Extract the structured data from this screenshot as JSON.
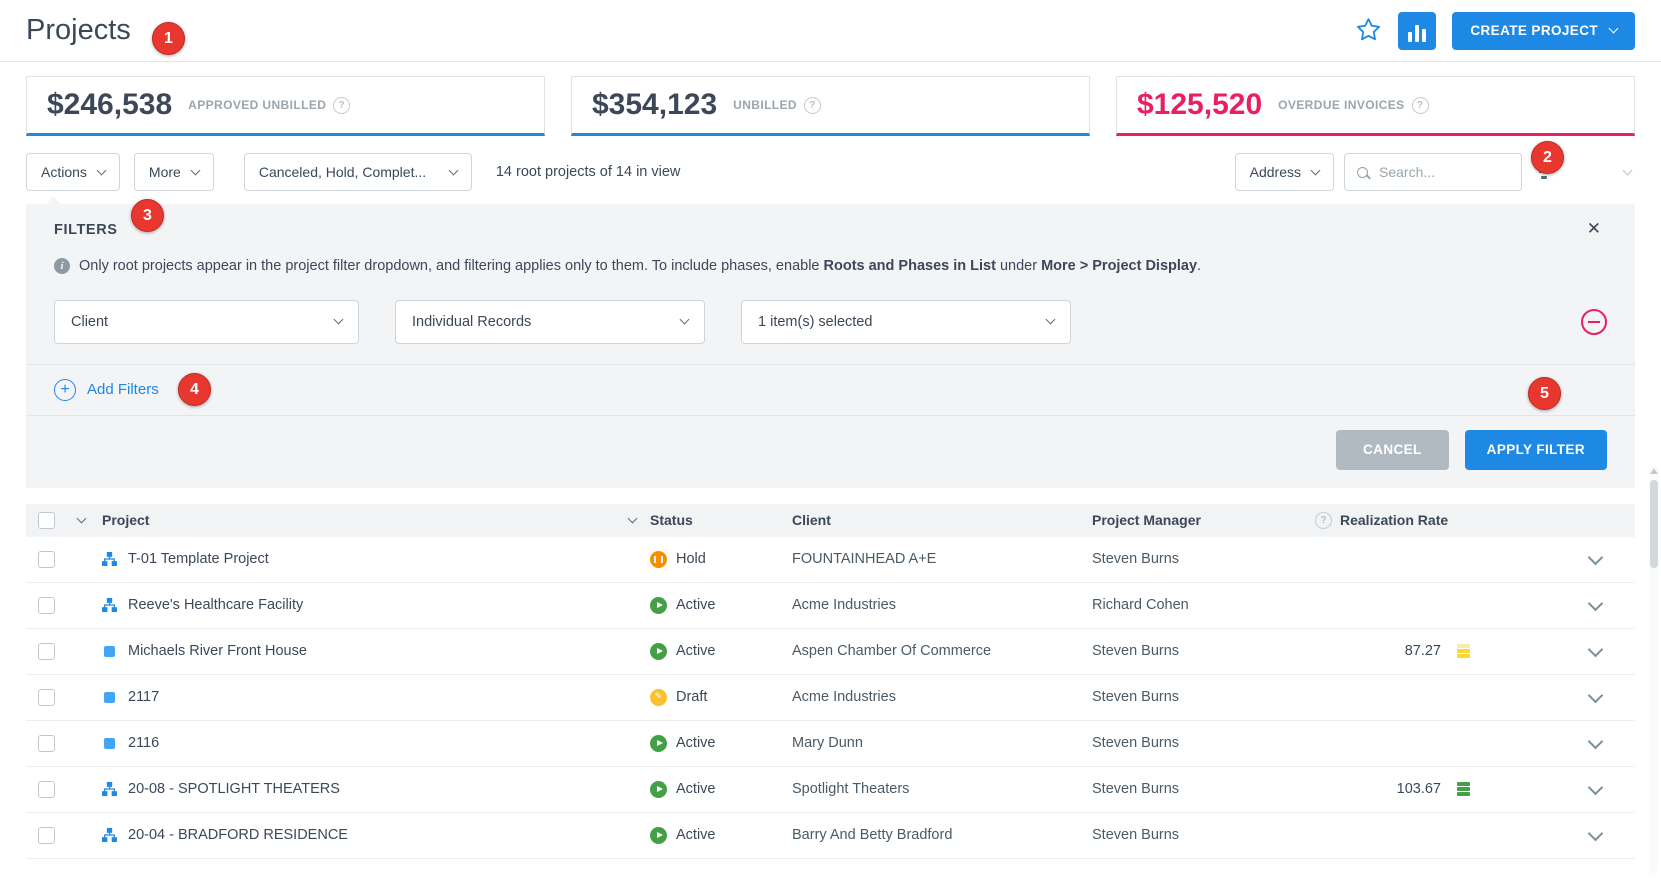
{
  "page": {
    "title": "Projects"
  },
  "header": {
    "create_button_label": "CREATE PROJECT"
  },
  "icons": {
    "info": "i",
    "help": "?",
    "close": "✕",
    "plus": "+"
  },
  "colors": {
    "accent_blue": "#1e88e5",
    "overdue_pink": "#e91e63",
    "badge_red": "#e8372f",
    "status_active": "#43a047",
    "status_hold": "#fb8c00",
    "status_draft": "#fbc02d"
  },
  "stats": {
    "cards": [
      {
        "value": "$246,538",
        "label": "APPROVED UNBILLED",
        "accent": "#1e88e5"
      },
      {
        "value": "$354,123",
        "label": "UNBILLED",
        "accent": "#1e88e5"
      },
      {
        "value": "$125,520",
        "label": "OVERDUE INVOICES",
        "accent": "#e91e63",
        "value_color": "#e91e63"
      }
    ]
  },
  "toolbar": {
    "actions_label": "Actions",
    "more_label": "More",
    "status_dropdown_value": "Canceled, Hold, Complet...",
    "count_text": "14 root projects of 14 in view",
    "address_label": "Address",
    "search_placeholder": "Search..."
  },
  "filters": {
    "title": "FILTERS",
    "info": {
      "text_1": "Only root projects appear in the project filter dropdown, and filtering applies only to them. To include phases, enable ",
      "bold_1": "Roots and Phases in List",
      "text_2": " under ",
      "bold_2": "More > Project Display",
      "text_3": "."
    },
    "row": {
      "field": "Client",
      "record_type": "Individual Records",
      "selection": "1 item(s) selected"
    },
    "add_filters_label": "Add Filters",
    "cancel_label": "CANCEL",
    "apply_label": "APPLY FILTER"
  },
  "table": {
    "headers": {
      "project": "Project",
      "status": "Status",
      "client": "Client",
      "manager": "Project Manager",
      "realization": "Realization Rate"
    },
    "rows": [
      {
        "name": "T-01 Template Project",
        "icon": "hierarchy",
        "status": "Hold",
        "status_type": "hold",
        "client": "FOUNTAINHEAD A+E",
        "manager": "Steven Burns",
        "rate": "",
        "rate_level": ""
      },
      {
        "name": "Reeve's Healthcare Facility",
        "icon": "hierarchy",
        "status": "Active",
        "status_type": "active",
        "client": "Acme Industries",
        "manager": "Richard Cohen",
        "rate": "",
        "rate_level": ""
      },
      {
        "name": "Michaels River Front House",
        "icon": "square",
        "status": "Active",
        "status_type": "active",
        "client": "Aspen Chamber Of Commerce",
        "manager": "Steven Burns",
        "rate": "87.27",
        "rate_level": "medium"
      },
      {
        "name": "2117",
        "icon": "square",
        "status": "Draft",
        "status_type": "draft",
        "client": "Acme Industries",
        "manager": "Steven Burns",
        "rate": "",
        "rate_level": ""
      },
      {
        "name": "2116",
        "icon": "square",
        "status": "Active",
        "status_type": "active",
        "client": "Mary Dunn",
        "manager": "Steven Burns",
        "rate": "",
        "rate_level": ""
      },
      {
        "name": "20-08 - SPOTLIGHT THEATERS",
        "icon": "hierarchy",
        "status": "Active",
        "status_type": "active",
        "client": "Spotlight Theaters",
        "manager": "Steven Burns",
        "rate": "103.67",
        "rate_level": "high"
      },
      {
        "name": "20-04 - BRADFORD RESIDENCE",
        "icon": "hierarchy",
        "status": "Active",
        "status_type": "active",
        "client": "Barry And Betty Bradford",
        "manager": "Steven Burns",
        "rate": "",
        "rate_level": ""
      }
    ]
  },
  "annotations": {
    "badges": [
      "1",
      "2",
      "3",
      "4",
      "5"
    ]
  }
}
